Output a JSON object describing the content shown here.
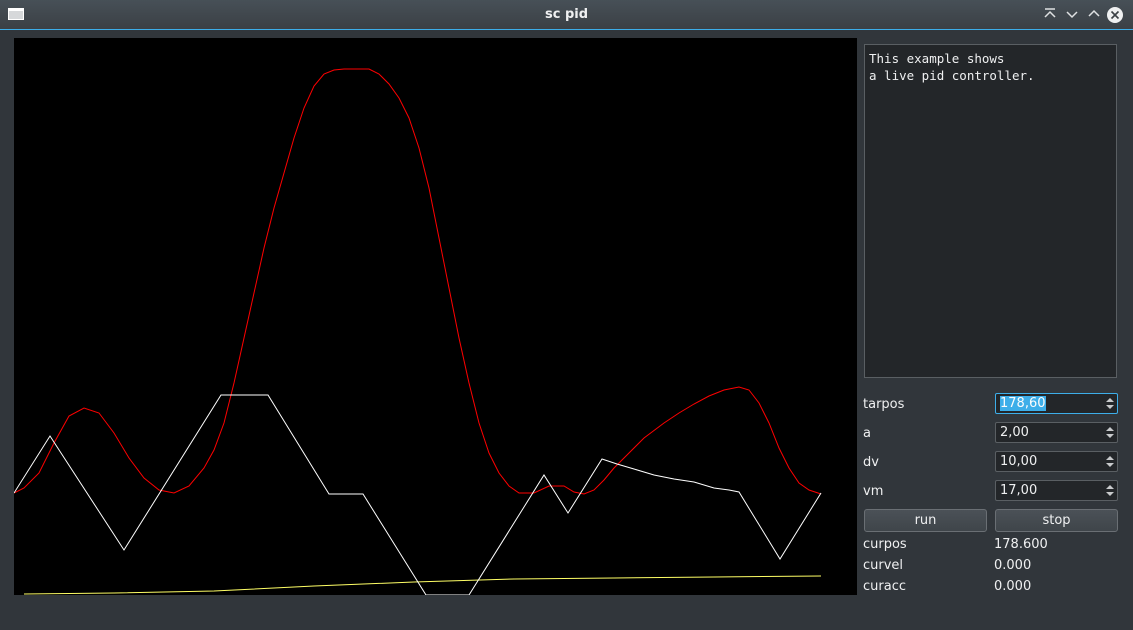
{
  "window": {
    "title": "sc pid"
  },
  "description": "This example shows\na live pid controller.",
  "params": [
    {
      "label": "tarpos",
      "value": "178,60",
      "selected": true
    },
    {
      "label": "a",
      "value": "2,00"
    },
    {
      "label": "dv",
      "value": "10,00"
    },
    {
      "label": "vm",
      "value": "17,00"
    }
  ],
  "buttons": {
    "run": "run",
    "stop": "stop"
  },
  "status": [
    {
      "label": "curpos",
      "value": "178.600"
    },
    {
      "label": "curvel",
      "value": "0.000"
    },
    {
      "label": "curacc",
      "value": "0.000"
    }
  ],
  "colors": {
    "position_trace": "#ff0000",
    "velocity_trace": "#ffffff",
    "acceleration_trace": "#ffff66"
  }
}
